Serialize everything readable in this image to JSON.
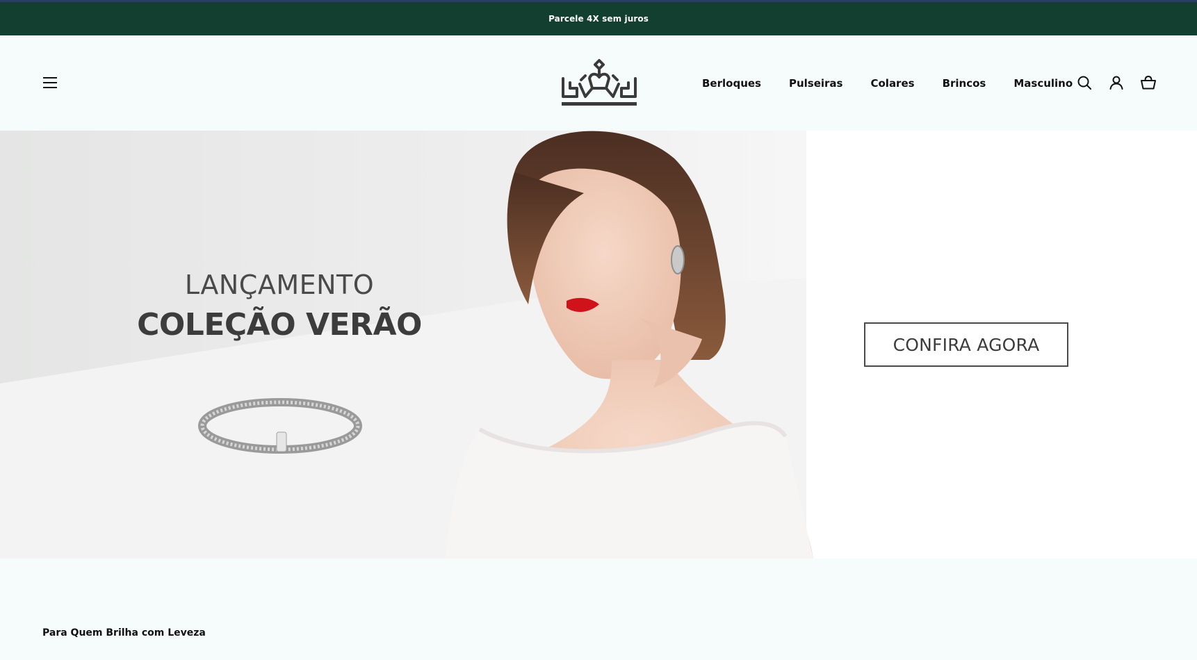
{
  "announcement": {
    "text": "Parcele 4X sem juros"
  },
  "header": {
    "menu_icon": "hamburger-menu-icon",
    "logo_icon": "crown-logo-icon",
    "nav": [
      {
        "label": "Berloques"
      },
      {
        "label": "Pulseiras"
      },
      {
        "label": "Colares"
      },
      {
        "label": "Brincos"
      },
      {
        "label": "Masculino"
      }
    ],
    "icons": [
      "search-icon",
      "account-icon",
      "cart-icon"
    ]
  },
  "hero": {
    "pretitle": "LANÇAMENTO",
    "title": "COLEÇÃO VERÃO",
    "cta_label": "CONFIRA AGORA"
  },
  "section": {
    "title": "Para Quem Brilha com Leveza"
  },
  "colors": {
    "announcement_bg": "#123f30",
    "page_bg": "#f6fbfc",
    "text": "#111111"
  }
}
